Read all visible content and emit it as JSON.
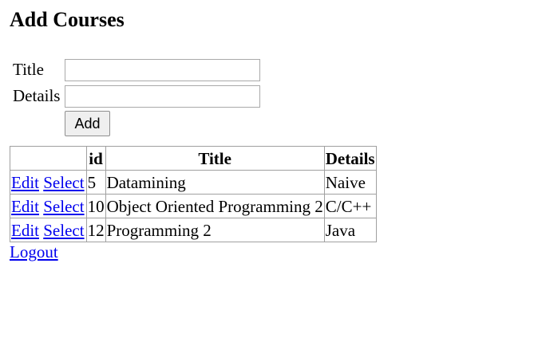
{
  "page": {
    "heading": "Add Courses"
  },
  "form": {
    "title_label": "Title",
    "title_value": "",
    "details_label": "Details",
    "details_value": "",
    "add_button": "Add"
  },
  "grid": {
    "columns": [
      "",
      "id",
      "Title",
      "Details"
    ],
    "edit_label": "Edit",
    "select_label": "Select",
    "rows": [
      {
        "id": "5",
        "title": "Datamining",
        "details": "Naive"
      },
      {
        "id": "10",
        "title": "Object Oriented Programming 2",
        "details": "C/C++"
      },
      {
        "id": "12",
        "title": "Programming 2",
        "details": "Java"
      }
    ]
  },
  "logout_label": "Logout",
  "colors": {
    "link": "#0000ee",
    "border": "#a0a0a0"
  }
}
